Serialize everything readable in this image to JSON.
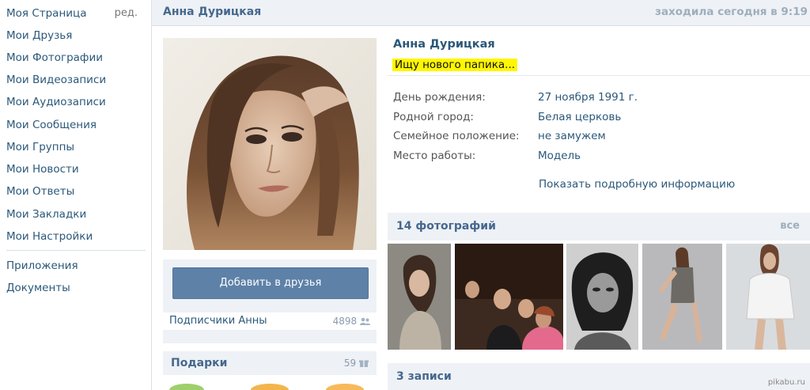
{
  "left_nav": {
    "items": [
      {
        "label": "Моя Страница"
      },
      {
        "label": "Мои Друзья"
      },
      {
        "label": "Мои Фотографии"
      },
      {
        "label": "Мои Видеозаписи"
      },
      {
        "label": "Мои Аудиозаписи"
      },
      {
        "label": "Мои Сообщения"
      },
      {
        "label": "Мои Группы"
      },
      {
        "label": "Мои Новости"
      },
      {
        "label": "Мои Ответы"
      },
      {
        "label": "Мои Закладки"
      },
      {
        "label": "Мои Настройки"
      },
      {
        "label": "Приложения"
      },
      {
        "label": "Документы"
      }
    ],
    "edit_label": "ред."
  },
  "header": {
    "name": "Анна Дурицкая",
    "last_seen": "заходила сегодня в 9:19"
  },
  "sidebar": {
    "add_friend_label": "Добавить в друзья",
    "followers_label": "Подписчики Анны",
    "followers_count": "4898",
    "gifts_label": "Подарки",
    "gifts_count": "59"
  },
  "info": {
    "full_name": "Анна Дурицкая",
    "status": "Ищу нового папика",
    "status_suffix": "...",
    "status_highlight_color": "#fff600",
    "rows": [
      {
        "key": "День рождения:",
        "value": "27 ноября 1991 г."
      },
      {
        "key": "Родной город:",
        "value": "Белая церковь"
      },
      {
        "key": "Семейное положение:",
        "value": "не замужем"
      },
      {
        "key": "Место работы:",
        "value": "Модель"
      }
    ],
    "more_info_label": "Показать подробную информацию"
  },
  "photos": {
    "title": "14 фотографий",
    "all_label": "все"
  },
  "posts": {
    "title": "3 записи"
  },
  "watermark": "pikabu.ru",
  "colors": {
    "link": "#2b587a",
    "header_bg": "#eef1f5",
    "button_bg": "#5e81a8"
  }
}
